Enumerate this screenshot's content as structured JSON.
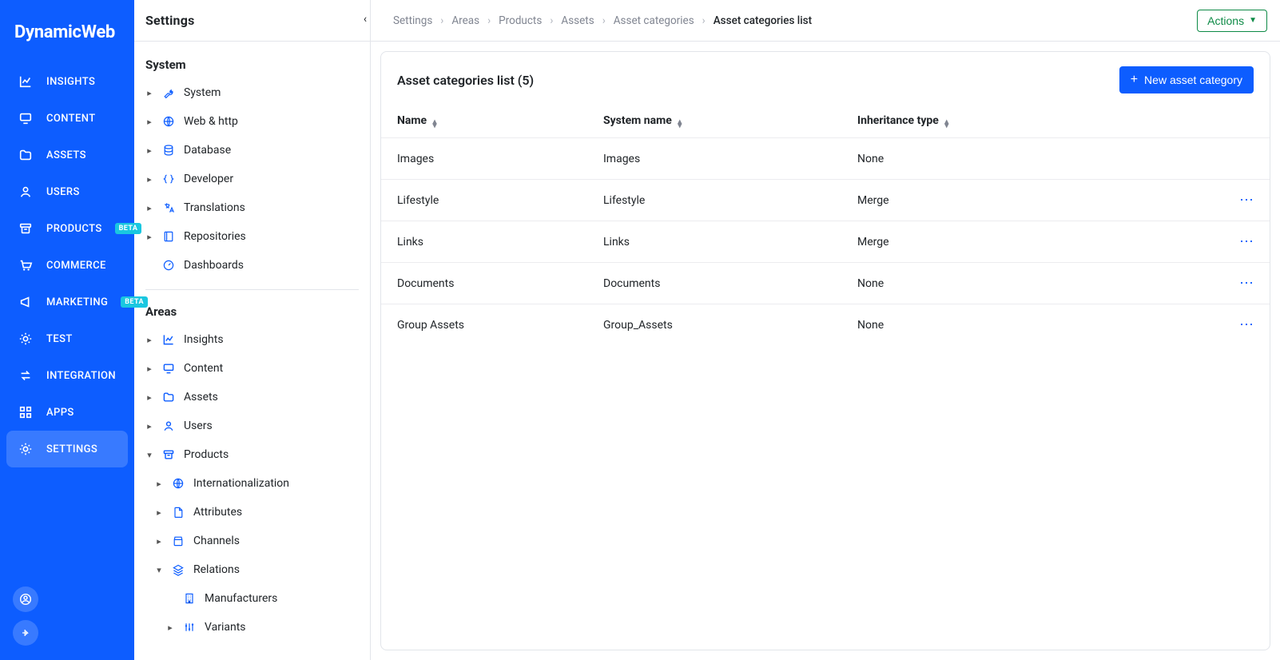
{
  "brand": "DynamicWeb",
  "nav": {
    "items": [
      {
        "id": "insights",
        "label": "INSIGHTS",
        "icon": "chart-line-icon",
        "badge": null,
        "active": false
      },
      {
        "id": "content",
        "label": "CONTENT",
        "icon": "desktop-icon",
        "badge": null,
        "active": false
      },
      {
        "id": "assets",
        "label": "ASSETS",
        "icon": "folder-icon",
        "badge": null,
        "active": false
      },
      {
        "id": "users",
        "label": "USERS",
        "icon": "user-icon",
        "badge": null,
        "active": false
      },
      {
        "id": "products",
        "label": "PRODUCTS",
        "icon": "archive-icon",
        "badge": "BETA",
        "active": false
      },
      {
        "id": "commerce",
        "label": "COMMERCE",
        "icon": "cart-icon",
        "badge": null,
        "active": false
      },
      {
        "id": "marketing",
        "label": "MARKETING",
        "icon": "megaphone-icon",
        "badge": "BETA",
        "active": false
      },
      {
        "id": "test",
        "label": "TEST",
        "icon": "gear-icon",
        "badge": null,
        "active": false
      },
      {
        "id": "integration",
        "label": "INTEGRATION",
        "icon": "swap-icon",
        "badge": null,
        "active": false
      },
      {
        "id": "apps",
        "label": "APPS",
        "icon": "grid-icon",
        "badge": null,
        "active": false
      },
      {
        "id": "settings",
        "label": "SETTINGS",
        "icon": "gear-icon",
        "badge": null,
        "active": true
      }
    ]
  },
  "settings": {
    "title": "Settings",
    "sections": [
      {
        "title": "System",
        "items": [
          {
            "label": "System",
            "icon": "wrench-icon",
            "depth": 0,
            "chev": "right"
          },
          {
            "label": "Web & http",
            "icon": "globe-icon",
            "depth": 0,
            "chev": "right"
          },
          {
            "label": "Database",
            "icon": "database-icon",
            "depth": 0,
            "chev": "right"
          },
          {
            "label": "Developer",
            "icon": "braces-icon",
            "depth": 0,
            "chev": "right"
          },
          {
            "label": "Translations",
            "icon": "translate-icon",
            "depth": 0,
            "chev": "right"
          },
          {
            "label": "Repositories",
            "icon": "repo-icon",
            "depth": 0,
            "chev": "right"
          },
          {
            "label": "Dashboards",
            "icon": "dashboard-icon",
            "depth": 0,
            "chev": "none"
          }
        ]
      },
      {
        "title": "Areas",
        "items": [
          {
            "label": "Insights",
            "icon": "chart-line-icon",
            "depth": 0,
            "chev": "right"
          },
          {
            "label": "Content",
            "icon": "desktop-icon",
            "depth": 0,
            "chev": "right"
          },
          {
            "label": "Assets",
            "icon": "folder-icon",
            "depth": 0,
            "chev": "right"
          },
          {
            "label": "Users",
            "icon": "user-icon",
            "depth": 0,
            "chev": "right"
          },
          {
            "label": "Products",
            "icon": "archive-icon",
            "depth": 0,
            "chev": "down"
          },
          {
            "label": "Internationalization",
            "icon": "globe-icon",
            "depth": 1,
            "chev": "right"
          },
          {
            "label": "Attributes",
            "icon": "file-icon",
            "depth": 1,
            "chev": "right"
          },
          {
            "label": "Channels",
            "icon": "store-icon",
            "depth": 1,
            "chev": "right"
          },
          {
            "label": "Relations",
            "icon": "layers-icon",
            "depth": 1,
            "chev": "down"
          },
          {
            "label": "Manufacturers",
            "icon": "building-icon",
            "depth": 2,
            "chev": "none"
          },
          {
            "label": "Variants",
            "icon": "sliders-icon",
            "depth": 2,
            "chev": "right"
          }
        ]
      }
    ]
  },
  "breadcrumb": {
    "items": [
      {
        "label": "Settings",
        "active": false
      },
      {
        "label": "Areas",
        "active": false
      },
      {
        "label": "Products",
        "active": false
      },
      {
        "label": "Assets",
        "active": false
      },
      {
        "label": "Asset categories",
        "active": false
      },
      {
        "label": "Asset categories list",
        "active": true
      }
    ]
  },
  "actions_button": "Actions",
  "list": {
    "title": "Asset categories list (5)",
    "new_button": "New asset category",
    "columns": {
      "name": "Name",
      "system_name": "System name",
      "inheritance_type": "Inheritance type"
    },
    "rows": [
      {
        "name": "Images",
        "system_name": "Images",
        "inheritance_type": "None",
        "show_menu": false
      },
      {
        "name": "Lifestyle",
        "system_name": "Lifestyle",
        "inheritance_type": "Merge",
        "show_menu": true
      },
      {
        "name": "Links",
        "system_name": "Links",
        "inheritance_type": "Merge",
        "show_menu": true
      },
      {
        "name": "Documents",
        "system_name": "Documents",
        "inheritance_type": "None",
        "show_menu": true
      },
      {
        "name": "Group Assets",
        "system_name": "Group_Assets",
        "inheritance_type": "None",
        "show_menu": true
      }
    ]
  }
}
